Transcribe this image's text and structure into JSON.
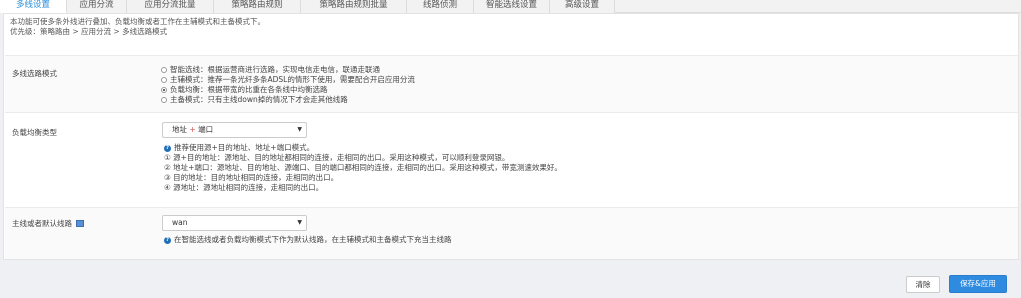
{
  "tabs": [
    {
      "label": "多线设置",
      "active": true
    },
    {
      "label": "应用分流",
      "active": false
    },
    {
      "label": "应用分流批量",
      "active": false
    },
    {
      "label": "策略路由规则",
      "active": false
    },
    {
      "label": "策略路由规则批量",
      "active": false
    },
    {
      "label": "线路侦测",
      "active": false
    },
    {
      "label": "智能选线设置",
      "active": false
    },
    {
      "label": "高级设置",
      "active": false
    }
  ],
  "info": {
    "line1": "本功能可使多条外线进行叠加、负载均衡或者工作在主辅模式和主备模式下。",
    "line2": "优先级：策略路由 > 应用分流 > 多线选路模式"
  },
  "mode_section": {
    "label": "多线选路模式",
    "options": [
      {
        "text": "智能选线：根据运营商进行选路，实现电信走电信，联通走联通",
        "checked": false
      },
      {
        "text": "主辅模式：推荐一条光纤多条ADSL的情形下使用，需要配合开启应用分流",
        "checked": false
      },
      {
        "text": "负载均衡：根据带宽的比重在各条线中均衡选路",
        "checked": true
      },
      {
        "text": "主备模式：只有主线down掉的情况下才会走其他线路",
        "checked": false
      }
    ]
  },
  "balance_section": {
    "label": "负载均衡类型",
    "select": {
      "part1": "地址",
      "plus": "+",
      "part2": "端口"
    },
    "help": "推荐使用源+目的地址、地址+端口模式。",
    "details": [
      "① 源+目的地址：源地址、目的地址都相同的连接，走相同的出口。采用这种模式，可以顺利登录网银。",
      "② 地址+端口：源地址、目的地址、源端口、目的端口都相同的连接，走相同的出口。采用这种模式，带宽测速效果好。",
      "③ 目的地址：目的地址相同的连接，走相同的出口。",
      "④ 源地址：源地址相同的连接，走相同的出口。"
    ]
  },
  "default_section": {
    "label": "主线或者默认线路",
    "select_value": "wan",
    "help": "在智能选线或者负载均衡模式下作为默认线路，在主辅模式和主备模式下充当主线路"
  },
  "buttons": {
    "clear": "清除",
    "save": "保存&应用"
  },
  "colors": {
    "accent": "#2f8be0",
    "active_tab_text": "#2a8fdc",
    "plus": "#d9534f"
  }
}
